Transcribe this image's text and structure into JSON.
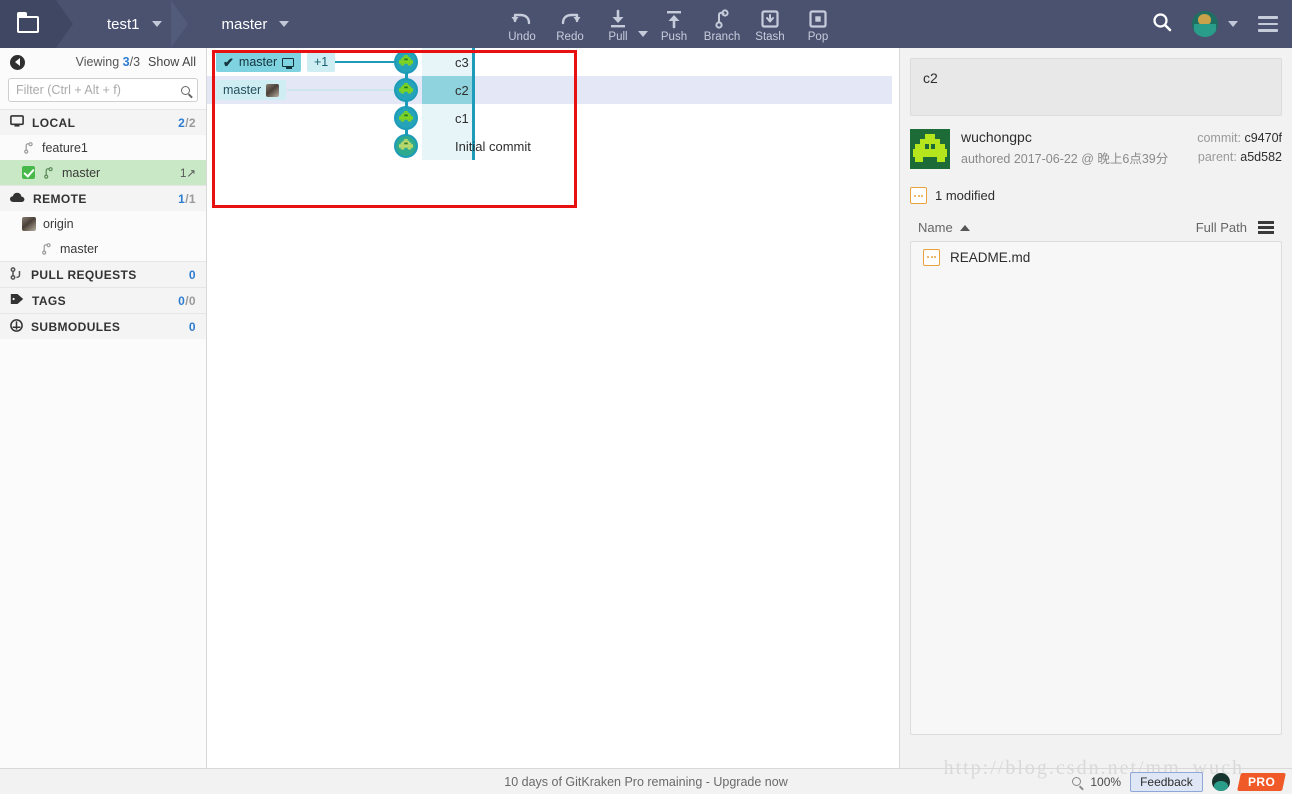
{
  "topbar": {
    "folder_icon": "folder-icon",
    "repo_name": "test1",
    "branch_name": "master",
    "tools": [
      {
        "label": "Undo",
        "icon": "undo-icon"
      },
      {
        "label": "Redo",
        "icon": "redo-icon"
      },
      {
        "label": "Pull",
        "icon": "pull-icon"
      },
      {
        "label": "Push",
        "icon": "push-icon"
      },
      {
        "label": "Branch",
        "icon": "branch-icon"
      },
      {
        "label": "Stash",
        "icon": "stash-icon"
      },
      {
        "label": "Pop",
        "icon": "pop-icon"
      }
    ],
    "search_icon": "search-icon",
    "avatar": "user-avatar",
    "menu_icon": "hamburger-menu-icon"
  },
  "sidebar": {
    "back_icon": "back-arrow-icon",
    "viewing_label": "Viewing",
    "viewing_current": "3",
    "viewing_total": "/3",
    "show_all": "Show All",
    "filter_placeholder": "Filter (Ctrl + Alt + f)",
    "filter_value": "",
    "sections": [
      {
        "name": "LOCAL",
        "icon": "monitor-icon",
        "count_a": "2",
        "count_b": "/2",
        "items": [
          {
            "label": "feature1",
            "active": false,
            "ahead": ""
          },
          {
            "label": "master",
            "active": true,
            "ahead": "1↗"
          }
        ]
      },
      {
        "name": "REMOTE",
        "icon": "cloud-icon",
        "count_a": "1",
        "count_b": "/1",
        "items": [
          {
            "label": "origin",
            "active": false,
            "ahead": ""
          },
          {
            "label": "master",
            "active": false,
            "ahead": ""
          }
        ]
      },
      {
        "name": "PULL REQUESTS",
        "icon": "pull-request-icon",
        "count_a": "",
        "count_b": "0",
        "items": []
      },
      {
        "name": "TAGS",
        "icon": "tag-icon",
        "count_a": "0",
        "count_b": "/0",
        "items": []
      },
      {
        "name": "SUBMODULES",
        "icon": "submodule-icon",
        "count_a": "",
        "count_b": "0",
        "items": []
      }
    ]
  },
  "graph": {
    "chips": {
      "current_branch": "master",
      "current_icon": "monitor-icon",
      "extra_count": "+1",
      "remote_branch": "master",
      "remote_icon": "remote-avatar-icon"
    },
    "commits": [
      {
        "message": "c3",
        "selected": false
      },
      {
        "message": "c2",
        "selected": true
      },
      {
        "message": "c1",
        "selected": false
      },
      {
        "message": "Initial commit",
        "selected": false
      }
    ]
  },
  "details": {
    "commit_message": "c2",
    "author": "wuchongpc",
    "authored_text": "authored 2017-06-22 @ 晚上6点39分",
    "commit_label": "commit:",
    "commit_hash": "c9470f",
    "parent_label": "parent:",
    "parent_hash": "a5d582",
    "modified_text": "1 modified",
    "modified_icon": "modified-file-icon",
    "columns": {
      "name": "Name",
      "full_path": "Full Path",
      "sort_icon": "sort-ascending-icon",
      "view_icon": "list-view-icon"
    },
    "files": [
      {
        "name": "README.md",
        "icon": "modified-file-icon"
      }
    ]
  },
  "statusbar": {
    "message": "10 days of GitKraken Pro remaining - Upgrade now",
    "zoom_icon": "zoom-icon",
    "zoom_level": "100%",
    "feedback": "Feedback",
    "avatar": "user-avatar",
    "pro_badge": "PRO",
    "watermark": "http://blog.csdn.net/mm_wuch"
  }
}
